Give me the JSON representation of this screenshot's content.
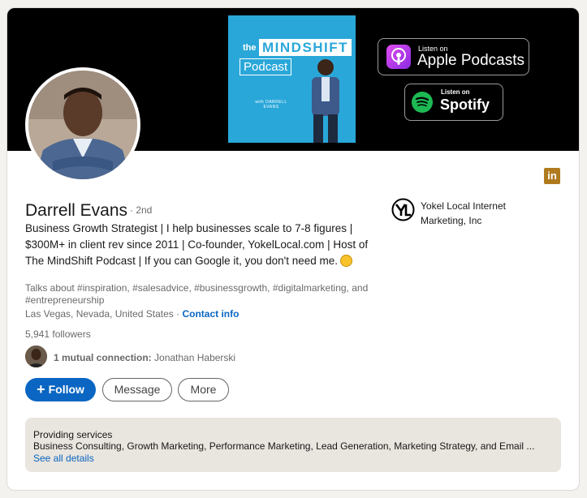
{
  "banner": {
    "podcast": {
      "the": "the",
      "mindshift": "MINDSHIFT",
      "podcast": "Podcast",
      "host": "with DARRELL EVANS"
    },
    "apple": {
      "small": "Listen on",
      "big": "Apple Podcasts"
    },
    "spotify": {
      "small": "Listen on",
      "big": "Spotify"
    }
  },
  "profile": {
    "name": "Darrell Evans",
    "degree": "· 2nd",
    "headline": "Business Growth Strategist | I help businesses scale to 7-8 figures | $300M+ in client rev since 2011 | Co-founder, YokelLocal.com | Host of The MindShift Podcast | If you can Google it, you don't need me.",
    "talks_about": "Talks about #inspiration, #salesadvice, #businessgrowth, #digitalmarketing, and #entrepreneurship",
    "location": "Las Vegas, Nevada, United States ·",
    "contact_info": "Contact info",
    "followers": "5,941 followers",
    "mutual_count": "1 mutual connection:",
    "mutual_name": "Jonathan Haberski"
  },
  "actions": {
    "follow": "Follow",
    "message": "Message",
    "more": "More"
  },
  "company": {
    "name": "Yokel Local Internet Marketing, Inc"
  },
  "linkedin_icon": "in",
  "services": {
    "title": "Providing services",
    "details": "Business Consulting, Growth Marketing, Performance Marketing, Lead Generation, Marketing Strategy, and Email ...",
    "link": "See all details"
  },
  "colors": {
    "accent": "#0a66c2",
    "banner": "#000000",
    "cover": "#2aa7d9"
  }
}
